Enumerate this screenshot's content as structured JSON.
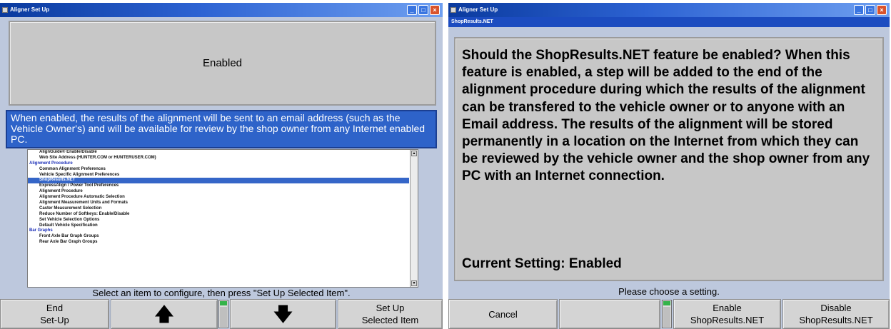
{
  "left_window": {
    "title": "Aligner Set Up",
    "status_value": "Enabled",
    "description": "When enabled, the results of the alignment will be sent to an email address (such as the Vehicle Owner's) and will be available for review by the shop owner from any Internet enabled PC.",
    "list_items": [
      {
        "label": "AlignGuide® Enable/Disable",
        "type": "item"
      },
      {
        "label": "Web Site Address (HUNTER.COM or HUNTERUSER.COM)",
        "type": "item"
      },
      {
        "label": "Alignment Procedure",
        "type": "group"
      },
      {
        "label": "Common Alignment Preferences",
        "type": "item"
      },
      {
        "label": "Vehicle Specific Alignment Preferences",
        "type": "item"
      },
      {
        "label": "ShopResults.NET",
        "type": "selected"
      },
      {
        "label": "ExpressAlign / Power Tool Preferences",
        "type": "item"
      },
      {
        "label": "Alignment Procedure",
        "type": "item"
      },
      {
        "label": "Alignment Procedure Automatic Selection",
        "type": "item"
      },
      {
        "label": "Alignment Measurement Units and Formats",
        "type": "item"
      },
      {
        "label": "Caster Measurement Selection",
        "type": "item"
      },
      {
        "label": "Reduce Number of Softkeys: Enable/Disable",
        "type": "item"
      },
      {
        "label": "Set Vehicle Selection Options",
        "type": "item"
      },
      {
        "label": "Default Vehicle Specification",
        "type": "item"
      },
      {
        "label": "Bar Graphs",
        "type": "group"
      },
      {
        "label": "Front Axle Bar Graph Groups",
        "type": "item"
      },
      {
        "label": "Rear Axle Bar Graph Groups",
        "type": "item"
      }
    ],
    "instruction": "Select an item to configure, then press \"Set Up Selected Item\".",
    "softkeys": {
      "end_line1": "End",
      "end_line2": "Set-Up",
      "up_arrow": "🡅",
      "down_arrow": "🡇",
      "setup_line1": "Set Up",
      "setup_line2": "Selected Item"
    }
  },
  "right_window": {
    "title": "Aligner Set Up",
    "subtitle": "ShopResults.NET",
    "message": "Should the ShopResults.NET feature be enabled? When this feature is enabled, a step will be added to the end of the alignment procedure during which the results of the alignment can be transfered to the vehicle owner or to anyone with an Email address. The results of the alignment will be stored permanently in a location on the Internet from which they can be reviewed by the vehicle owner and the shop owner from any PC with an Internet connection.",
    "current_setting": "Current Setting: Enabled",
    "instruction": "Please choose a setting.",
    "softkeys": {
      "cancel": "Cancel",
      "enable_line1": "Enable",
      "enable_line2": "ShopResults.NET",
      "disable_line1": "Disable",
      "disable_line2": "ShopResults.NET"
    }
  },
  "window_buttons": {
    "minimize": "_",
    "maximize": "□",
    "close": "×"
  },
  "colors": {
    "window_background": "#bdc8dd",
    "title_bar": "#2d63d3",
    "highlight": "#2e63c9",
    "panel_gray": "#c7c7c7",
    "meter_green": "#34b34a"
  },
  "icons": [
    "app-icon",
    "up-arrow-icon",
    "down-arrow-icon",
    "level-meter-icon",
    "scroll-up-icon",
    "scroll-down-icon"
  ]
}
